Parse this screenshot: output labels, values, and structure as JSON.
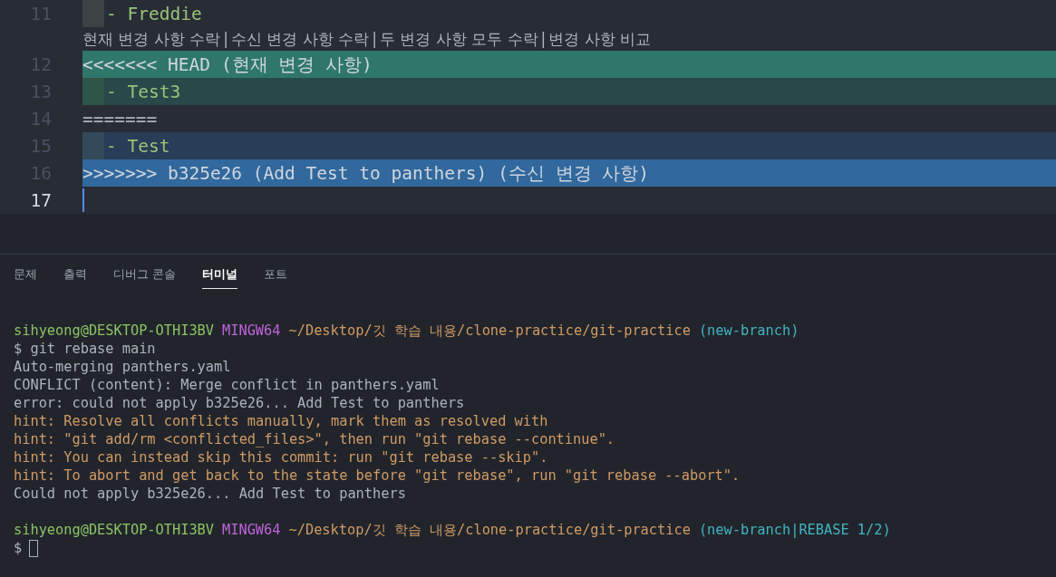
{
  "editor": {
    "lines": [
      {
        "kind": "code",
        "number": "11",
        "text": "- Freddie",
        "indent": true,
        "active": false
      },
      {
        "kind": "codelens",
        "actions": [
          "현재 변경 사항 수락",
          "수신 변경 사항 수락",
          "두 변경 사항 모두 수락",
          "변경 사항 비교"
        ],
        "separator": "|"
      },
      {
        "kind": "current-marker",
        "number": "12",
        "text": "<<<<<<< HEAD",
        "note": "(현재 변경 사항)",
        "indent": false,
        "active": false
      },
      {
        "kind": "current",
        "number": "13",
        "text": "- Test3",
        "indent": true,
        "active": false
      },
      {
        "kind": "code",
        "number": "14",
        "text": "=======",
        "indent": false,
        "active": false
      },
      {
        "kind": "incoming",
        "number": "15",
        "text": "- Test",
        "indent": true,
        "active": false
      },
      {
        "kind": "incoming-marker",
        "number": "16",
        "text": ">>>>>>> b325e26 (Add Test to panthers)",
        "note": "(수신 변경 사항)",
        "indent": false,
        "active": false
      },
      {
        "kind": "code",
        "number": "17",
        "indent": false,
        "active": true
      }
    ]
  },
  "panel": {
    "tabs": [
      {
        "label": "문제",
        "selected": false
      },
      {
        "label": "출력",
        "selected": false
      },
      {
        "label": "디버그 콘솔",
        "selected": false
      },
      {
        "label": "터미널",
        "selected": true
      },
      {
        "label": "포트",
        "selected": false
      }
    ],
    "terminal": [
      {
        "spaced": false,
        "segments": [
          {
            "kind": "user",
            "text": "sihyeong@DESKTOP-OTHI3BV"
          },
          {
            "kind": "system",
            "text": "MINGW64"
          },
          {
            "kind": "path",
            "text": "~/Desktop/깃 학습 내용/clone-practice/git-practice"
          },
          {
            "kind": "branch",
            "text": "(new-branch)"
          }
        ]
      },
      {
        "spaced": false,
        "segments": [
          {
            "kind": "plain",
            "text": "$ git rebase main"
          }
        ]
      },
      {
        "spaced": false,
        "segments": [
          {
            "kind": "plain",
            "text": "Auto-merging panthers.yaml"
          }
        ]
      },
      {
        "spaced": false,
        "segments": [
          {
            "kind": "plain",
            "text": "CONFLICT (content): Merge conflict in panthers.yaml"
          }
        ]
      },
      {
        "spaced": false,
        "segments": [
          {
            "kind": "plain",
            "text": "error: could not apply b325e26... Add Test to panthers"
          }
        ]
      },
      {
        "spaced": false,
        "segments": [
          {
            "kind": "hint",
            "text": "hint: Resolve all conflicts manually, mark them as resolved with"
          }
        ]
      },
      {
        "spaced": false,
        "segments": [
          {
            "kind": "hint",
            "text": "hint: \"git add/rm <conflicted_files>\", then run \"git rebase --continue\"."
          }
        ]
      },
      {
        "spaced": false,
        "segments": [
          {
            "kind": "hint",
            "text": "hint: You can instead skip this commit: run \"git rebase --skip\"."
          }
        ]
      },
      {
        "spaced": false,
        "segments": [
          {
            "kind": "hint",
            "text": "hint: To abort and get back to the state before \"git rebase\", run \"git rebase --abort\"."
          }
        ]
      },
      {
        "spaced": false,
        "segments": [
          {
            "kind": "plain",
            "text": "Could not apply b325e26... Add Test to panthers"
          }
        ]
      },
      {
        "spaced": true,
        "segments": [
          {
            "kind": "user",
            "text": "sihyeong@DESKTOP-OTHI3BV"
          },
          {
            "kind": "system",
            "text": "MINGW64"
          },
          {
            "kind": "path",
            "text": "~/Desktop/깃 학습 내용/clone-practice/git-practice"
          },
          {
            "kind": "branch",
            "text": "(new-branch|REBASE 1/2)"
          }
        ]
      },
      {
        "spaced": false,
        "segments": [
          {
            "kind": "plain",
            "text": "$"
          },
          {
            "kind": "cursor"
          }
        ]
      }
    ]
  }
}
